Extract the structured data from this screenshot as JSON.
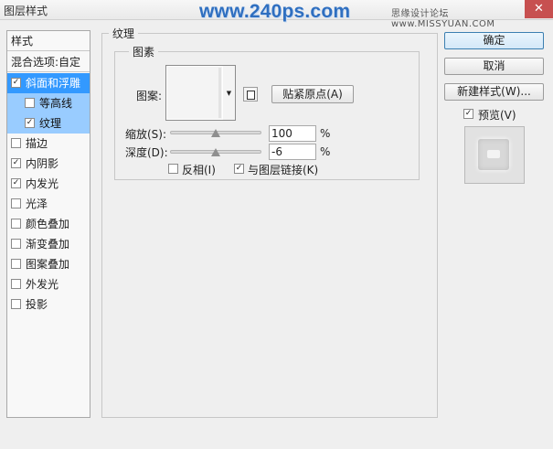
{
  "window": {
    "title": "图层样式",
    "watermark": "www.240ps.com",
    "forum_text": "思缘设计论坛 www.MISSYUAN.COM",
    "close_glyph": "✕"
  },
  "style_list": {
    "header": "样式",
    "blend_options": "混合选项:自定",
    "items": [
      {
        "label": "斜面和浮雕",
        "checked": true
      },
      {
        "label": "等高线",
        "checked": false
      },
      {
        "label": "纹理",
        "checked": true
      },
      {
        "label": "描边",
        "checked": false
      },
      {
        "label": "内阴影",
        "checked": true
      },
      {
        "label": "内发光",
        "checked": true
      },
      {
        "label": "光泽",
        "checked": false
      },
      {
        "label": "颜色叠加",
        "checked": false
      },
      {
        "label": "渐变叠加",
        "checked": false
      },
      {
        "label": "图案叠加",
        "checked": false
      },
      {
        "label": "外发光",
        "checked": false
      },
      {
        "label": "投影",
        "checked": false
      }
    ]
  },
  "texture": {
    "group_title": "纹理",
    "pattern_group_title": "图素",
    "pattern_label": "图案:",
    "dropdown_glyph": "▼",
    "snap_button": "贴紧原点(A)",
    "scale": {
      "label": "缩放(S):",
      "value": "100",
      "unit": "%",
      "slider_fraction": 0.5
    },
    "depth": {
      "label": "深度(D):",
      "value": "-6",
      "unit": "%",
      "slider_fraction": 0.5
    },
    "invert": {
      "label": "反相(I)",
      "checked": false
    },
    "link": {
      "label": "与图层链接(K)",
      "checked": true
    }
  },
  "actions": {
    "ok": "确定",
    "cancel": "取消",
    "new_style": "新建样式(W)...",
    "preview_label": "预览(V)",
    "preview_checked": true
  },
  "check_glyph": "✓"
}
